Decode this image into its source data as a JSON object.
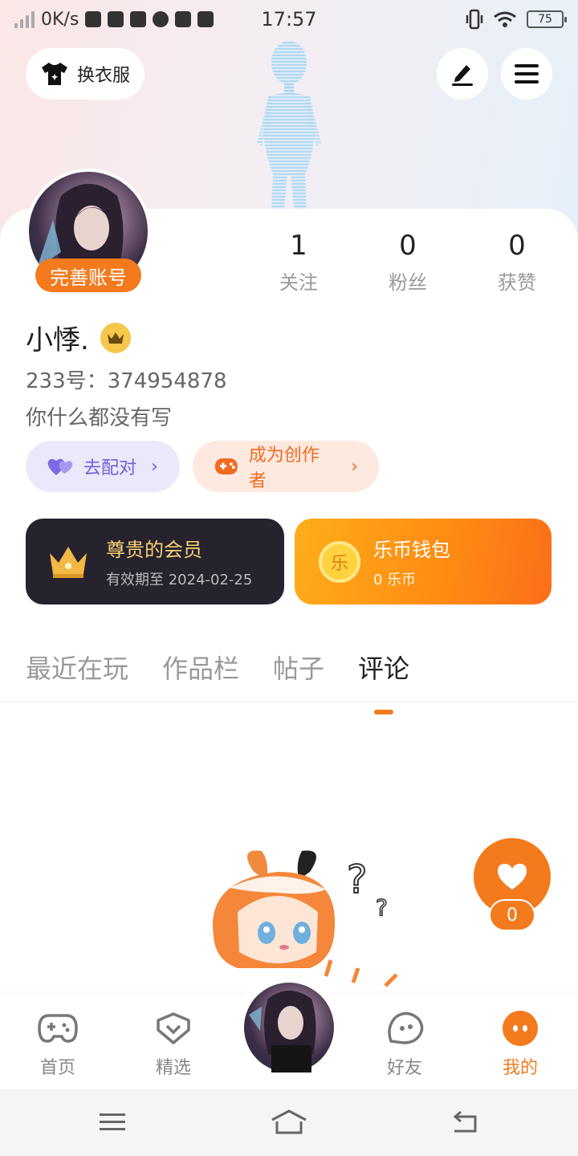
{
  "status_bar": {
    "speed": "0K/s",
    "time": "17:57",
    "battery": "75"
  },
  "header": {
    "outfit_label": "换衣服"
  },
  "profile": {
    "badge": "完善账号",
    "stats": [
      {
        "count": "1",
        "label": "关注"
      },
      {
        "count": "0",
        "label": "粉丝"
      },
      {
        "count": "0",
        "label": "获赞"
      }
    ],
    "name": "小悸.",
    "id_line": "233号：374954878",
    "bio": "你什么都没有写"
  },
  "actions": {
    "match_label": "去配对",
    "creator_label": "成为创作者"
  },
  "membership": {
    "title": "尊贵的会员",
    "expiry": "有效期至 2024-02-25"
  },
  "wallet": {
    "title": "乐币钱包",
    "balance": "0 乐币",
    "coin_glyph": "乐"
  },
  "tabs": [
    {
      "label": "最近在玩"
    },
    {
      "label": "作品栏"
    },
    {
      "label": "帖子"
    },
    {
      "label": "评论"
    }
  ],
  "active_tab": "评论",
  "like": {
    "count": "0"
  },
  "bottom_nav": [
    {
      "label": "首页",
      "icon": "gamepad-icon"
    },
    {
      "label": "精选",
      "icon": "heart-chat-icon"
    },
    {
      "label": "好友",
      "icon": "friend-face-icon"
    },
    {
      "label": "我的",
      "icon": "profile-face-icon"
    }
  ],
  "colors": {
    "accent": "#f47a1e",
    "match": "#6f5fd8",
    "member_card": "#26222e",
    "gold": "#f5c74a"
  }
}
